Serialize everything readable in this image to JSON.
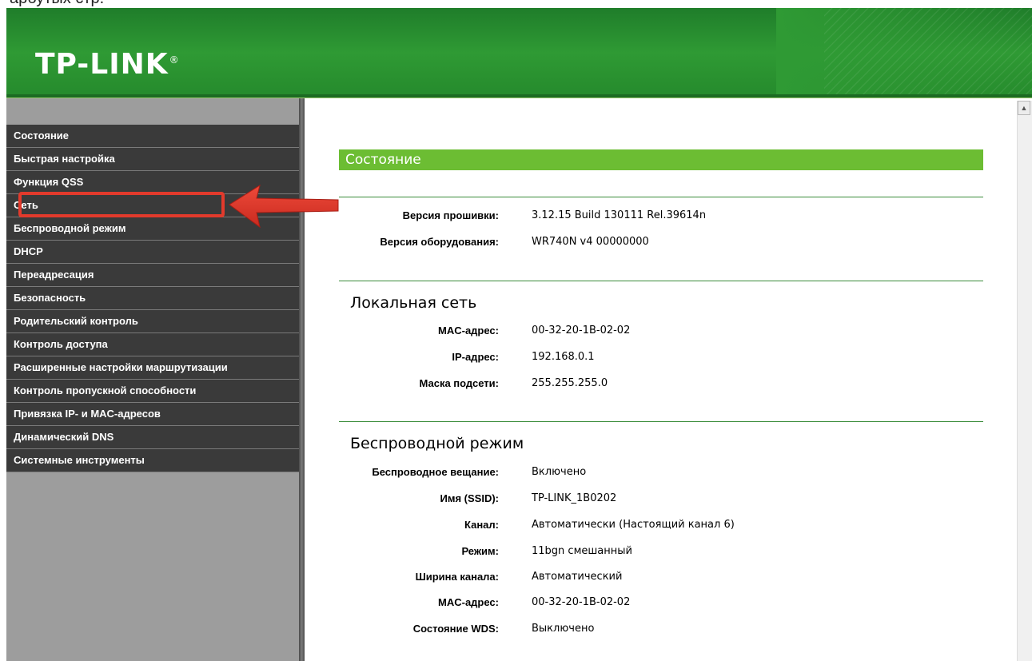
{
  "top_caption": "арбутых стр.",
  "brand": {
    "logo_text": "TP-LINK",
    "logo_mark": "®"
  },
  "sidebar": {
    "items": [
      {
        "label": "Состояние"
      },
      {
        "label": "Быстрая настройка"
      },
      {
        "label": "Функция QSS"
      },
      {
        "label": "Сеть"
      },
      {
        "label": "Беспроводной режим"
      },
      {
        "label": "DHCP"
      },
      {
        "label": "Переадресация"
      },
      {
        "label": "Безопасность"
      },
      {
        "label": "Родительский контроль"
      },
      {
        "label": "Контроль доступа"
      },
      {
        "label": "Расширенные настройки маршрутизации"
      },
      {
        "label": "Контроль пропускной способности"
      },
      {
        "label": "Привязка IP- и MAC-адресов"
      },
      {
        "label": "Динамический DNS"
      },
      {
        "label": "Системные инструменты"
      }
    ],
    "highlighted_item": "Сеть"
  },
  "main": {
    "title": "Состояние",
    "firmware": {
      "fw_label": "Версия прошивки:",
      "fw_value": "3.12.15 Build 130111 Rel.39614n",
      "hw_label": "Версия оборудования:",
      "hw_value": "WR740N v4 00000000"
    },
    "lan": {
      "title": "Локальная сеть",
      "mac_label": "MAC-адрес:",
      "mac_value": "00-32-20-1B-02-02",
      "ip_label": "IP-адрес:",
      "ip_value": "192.168.0.1",
      "mask_label": "Маска подсети:",
      "mask_value": "255.255.255.0"
    },
    "wireless": {
      "title": "Беспроводной режим",
      "broadcast_label": "Беспроводное вещание:",
      "broadcast_value": "Включено",
      "ssid_label": "Имя (SSID):",
      "ssid_value": "TP-LINK_1B0202",
      "channel_label": "Канал:",
      "channel_value": "Автоматически (Настоящий канал 6)",
      "mode_label": "Режим:",
      "mode_value": "11bgn смешанный",
      "width_label": "Ширина канала:",
      "width_value": "Автоматический",
      "mac_label": "MAC-адрес:",
      "mac_value": "00-32-20-1B-02-02",
      "wds_label": "Состояние WDS:",
      "wds_value": "Выключено"
    }
  },
  "colors": {
    "header_green": "#2f9a34",
    "status_bar_green": "#6cbd33",
    "menu_bg": "#3a3a3a",
    "highlight_red": "#e23a2c"
  }
}
